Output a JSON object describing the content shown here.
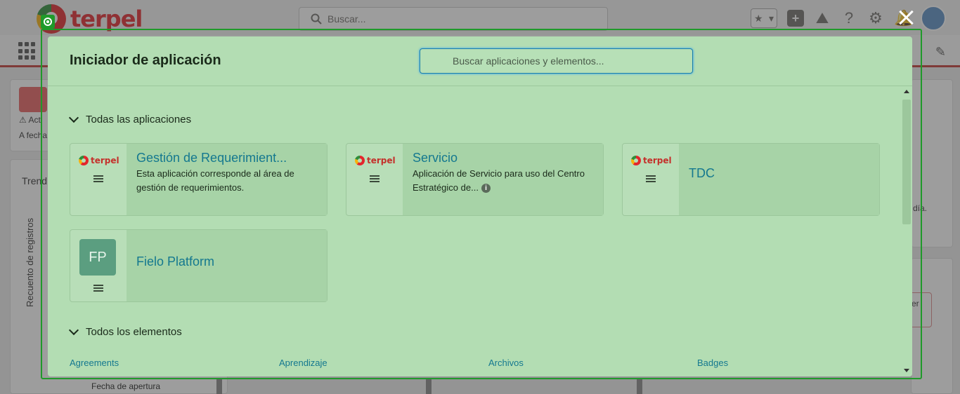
{
  "background": {
    "logo_text": "terpel",
    "search_placeholder": "Buscar...",
    "card_text_1": "Act",
    "card_text_2": "A fecha",
    "trend_label": "Trend",
    "vertical_label": "Recuento de registros",
    "date_label": "Fecha de apertura",
    "right_text": "día.",
    "right_btn_text": "ver"
  },
  "launcher": {
    "title": "Iniciador de aplicación",
    "search_placeholder": "Buscar aplicaciones y elementos...",
    "all_apps_label": "Todas las aplicaciones",
    "all_items_label": "Todos los elementos",
    "close_label": "×",
    "apps": [
      {
        "logo_text": "terpel",
        "name": "Gestión de Requerimient...",
        "description": "Esta aplicación corresponde al área de gestión de requerimientos."
      },
      {
        "logo_text": "terpel",
        "name": "Servicio",
        "description": "Aplicación de Servicio para uso del Centro Estratégico de..."
      },
      {
        "logo_text": "terpel",
        "name": "TDC",
        "description": ""
      },
      {
        "tile_text": "FP",
        "name": "Fielo Platform",
        "description": ""
      }
    ],
    "items": [
      "Agreements",
      "Aprendizaje",
      "Archivos",
      "Badges"
    ]
  }
}
